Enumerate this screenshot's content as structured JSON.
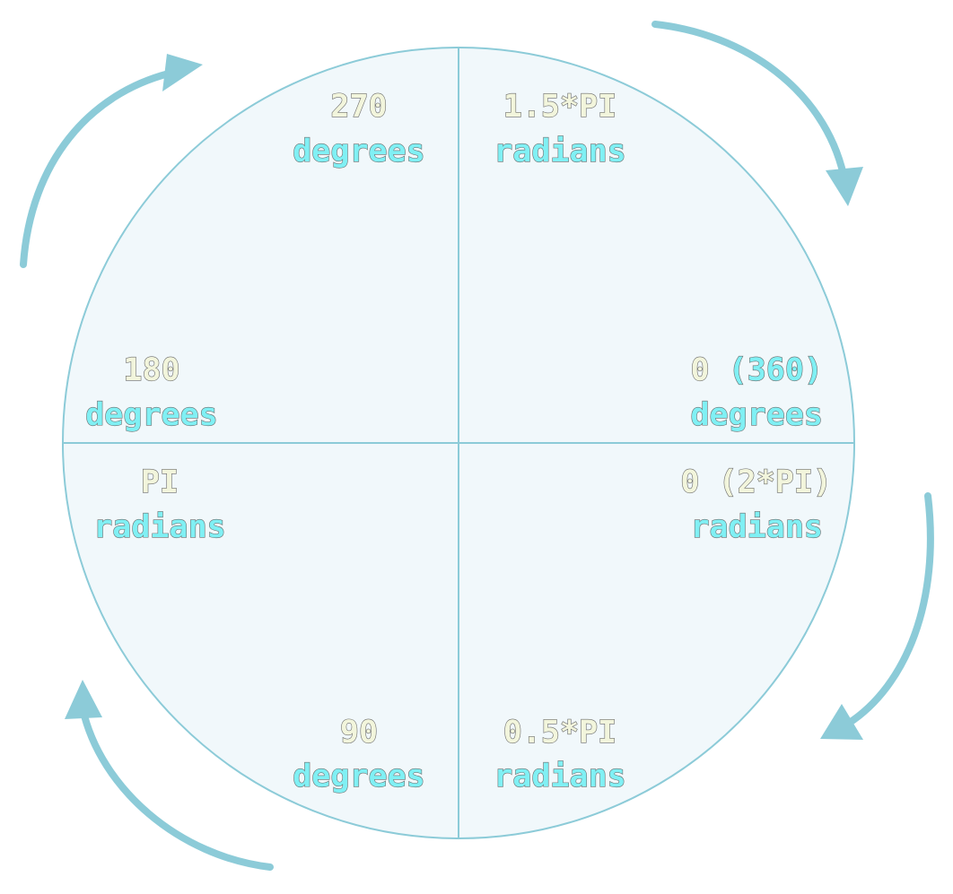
{
  "colors": {
    "accent": "#8ccbd8",
    "circle_fill": "#f1f8fb",
    "number_text": "#f2f5dc",
    "word_text": "#80f0f4"
  },
  "labels": {
    "deg_270_value": "270",
    "deg_270_unit": "degrees",
    "rad_1_5pi_value": "1.5*PI",
    "rad_1_5pi_unit": "radians",
    "deg_180_value": "180",
    "deg_180_unit": "degrees",
    "rad_pi_value": "PI",
    "rad_pi_unit": "radians",
    "deg_0_value": "0",
    "deg_0_alt": "(360)",
    "deg_0_unit": "degrees",
    "rad_0_value": "0",
    "rad_0_alt": "(2*PI)",
    "rad_0_unit": "radians",
    "deg_90_value": "90",
    "deg_90_unit": "degrees",
    "rad_0_5pi_value": "0.5*PI",
    "rad_0_5pi_unit": "radians"
  },
  "icons": {
    "arrows": [
      "curved-arrow-icon",
      "curved-arrow-icon",
      "curved-arrow-icon",
      "curved-arrow-icon"
    ]
  }
}
